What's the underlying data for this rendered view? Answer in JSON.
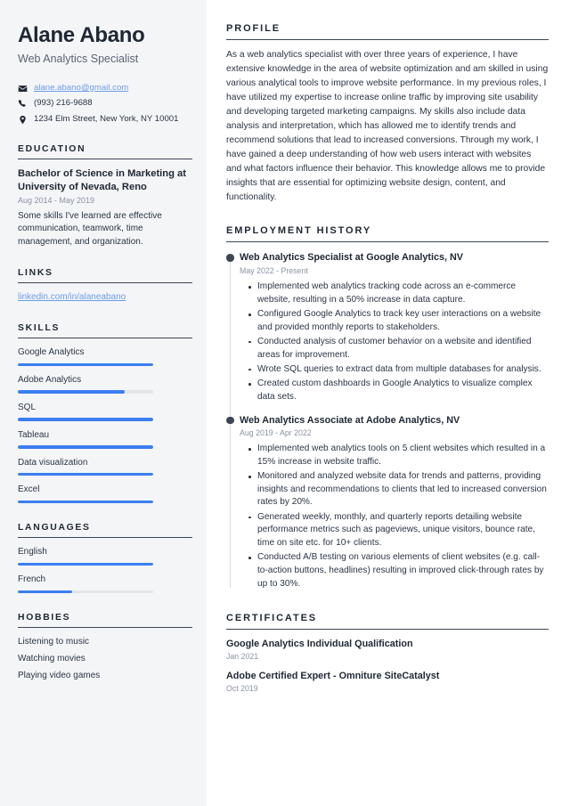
{
  "theme": {
    "accent": "#3b7ef0",
    "link": "#6c9ce8",
    "sidebar_bg": "#f4f5f7",
    "heading": "#1f2733",
    "body_text": "#2b3445",
    "muted": "#8b93a1",
    "rule": "#3d4654",
    "timeline_dot": "#3d4654"
  },
  "header": {
    "name": "Alane Abano",
    "title": "Web Analytics Specialist"
  },
  "contact": [
    {
      "icon": "envelope-icon",
      "text": "alane.abano@gmail.com",
      "is_link": true
    },
    {
      "icon": "phone-icon",
      "text": "(993) 216-9688",
      "is_link": false
    },
    {
      "icon": "location-pin-icon",
      "text": "1234 Elm Street, New York, NY 10001",
      "is_link": false
    }
  ],
  "education": {
    "heading": "EDUCATION",
    "items": [
      {
        "degree": "Bachelor of Science in Marketing at University of Nevada, Reno",
        "date": "Aug 2014 - May 2019",
        "description": "Some skills I've learned are effective communication, teamwork, time management, and organization."
      }
    ]
  },
  "links": {
    "heading": "LINKS",
    "items": [
      {
        "label": "linkedin.com/in/alaneabano"
      }
    ]
  },
  "skills": {
    "heading": "SKILLS",
    "items": [
      {
        "label": "Google Analytics",
        "level": 100
      },
      {
        "label": "Adobe Analytics",
        "level": 79
      },
      {
        "label": "SQL",
        "level": 100
      },
      {
        "label": "Tableau",
        "level": 100
      },
      {
        "label": "Data visualization",
        "level": 100
      },
      {
        "label": "Excel",
        "level": 100
      }
    ]
  },
  "languages": {
    "heading": "LANGUAGES",
    "items": [
      {
        "label": "English",
        "level": 100
      },
      {
        "label": "French",
        "level": 40
      }
    ]
  },
  "hobbies": {
    "heading": "HOBBIES",
    "items": [
      {
        "label": "Listening to music"
      },
      {
        "label": "Watching movies"
      },
      {
        "label": "Playing video games"
      }
    ]
  },
  "profile": {
    "heading": "PROFILE",
    "text": "As a web analytics specialist with over three years of experience, I have extensive knowledge in the area of website optimization and am skilled in using various analytical tools to improve website performance. In my previous roles, I have utilized my expertise to increase online traffic by improving site usability and developing targeted marketing campaigns. My skills also include data analysis and interpretation, which has allowed me to identify trends and recommend solutions that lead to increased conversions. Through my work, I have gained a deep understanding of how web users interact with websites and what factors influence their behavior. This knowledge allows me to provide insights that are essential for optimizing website design, content, and functionality."
  },
  "employment": {
    "heading": "EMPLOYMENT HISTORY",
    "jobs": [
      {
        "role": "Web Analytics Specialist at Google Analytics, NV",
        "date": "May 2022 - Present",
        "points": [
          "Implemented web analytics tracking code across an e-commerce website, resulting in a 50% increase in data capture.",
          "Configured Google Analytics to track key user interactions on a website and provided monthly reports to stakeholders.",
          "Conducted analysis of customer behavior on a website and identified areas for improvement.",
          "Wrote SQL queries to extract data from multiple databases for analysis.",
          "Created custom dashboards in Google Analytics to visualize complex data sets."
        ]
      },
      {
        "role": "Web Analytics Associate at Adobe Analytics, NV",
        "date": "Aug 2019 - Apr 2022",
        "points": [
          "Implemented web analytics tools on 5 client websites which resulted in a 15% increase in website traffic.",
          "Monitored and analyzed website data for trends and patterns, providing insights and recommendations to clients that led to increased conversion rates by 20%.",
          "Generated weekly, monthly, and quarterly reports detailing website performance metrics such as pageviews, unique visitors, bounce rate, time on site etc. for 10+ clients.",
          "Conducted A/B testing on various elements of client websites (e.g. call-to-action buttons, headlines) resulting in improved click-through rates by up to 30%."
        ]
      }
    ]
  },
  "certificates": {
    "heading": "CERTIFICATES",
    "items": [
      {
        "name": "Google Analytics Individual Qualification",
        "date": "Jan 2021"
      },
      {
        "name": "Adobe Certified Expert - Omniture SiteCatalyst",
        "date": "Oct 2019"
      }
    ]
  }
}
